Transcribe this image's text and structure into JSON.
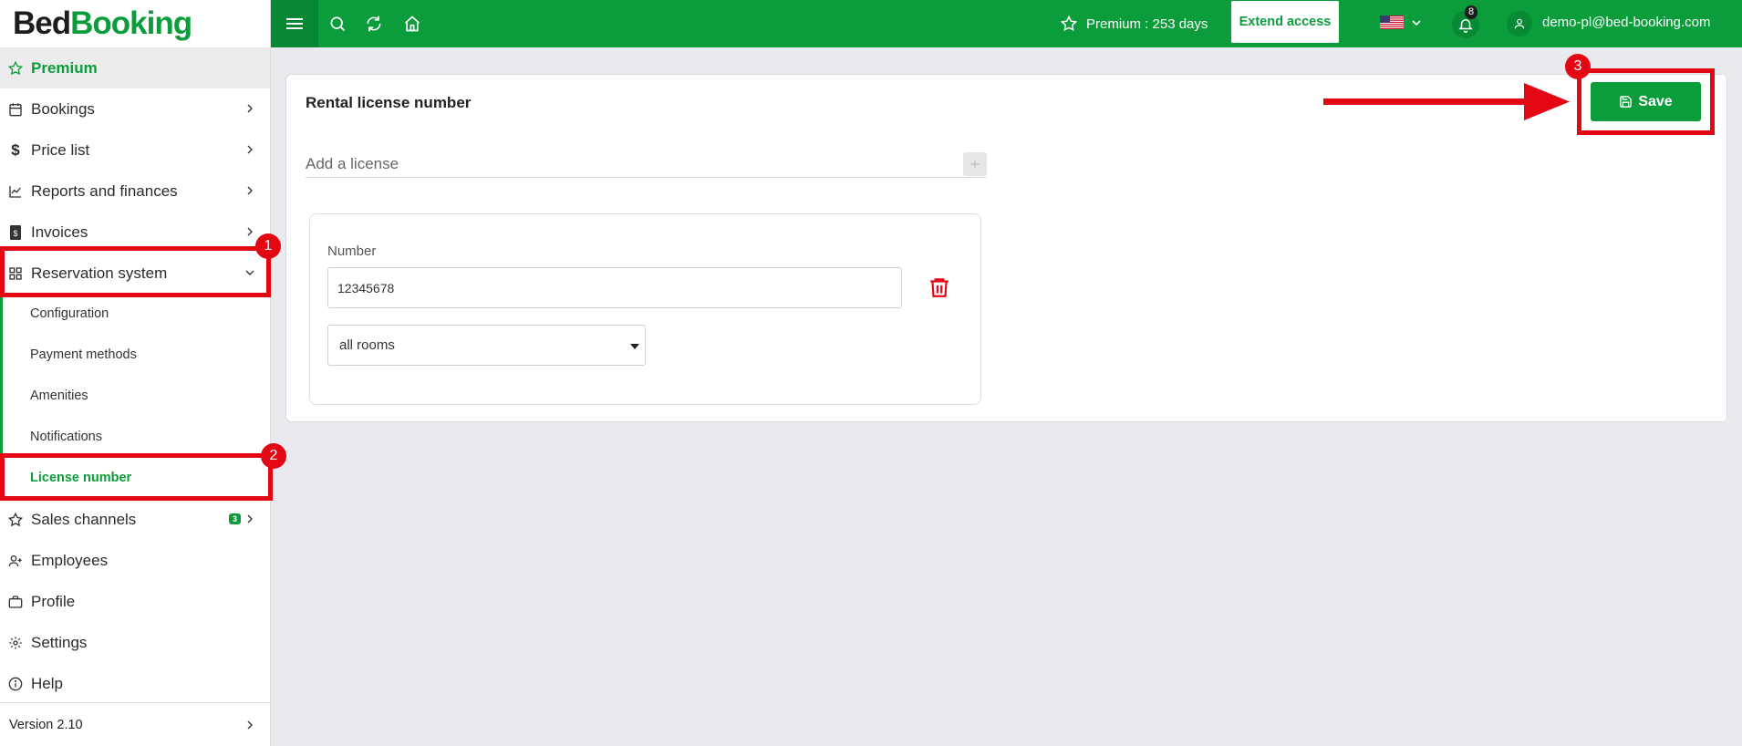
{
  "brand": {
    "part1": "Bed",
    "part2": "Booking"
  },
  "sidebar": {
    "premium": "Premium",
    "items": [
      {
        "label": "Bookings"
      },
      {
        "label": "Price list"
      },
      {
        "label": "Reports and finances"
      },
      {
        "label": "Invoices"
      },
      {
        "label": "Reservation system"
      }
    ],
    "sub_items": [
      {
        "label": "Configuration"
      },
      {
        "label": "Payment methods"
      },
      {
        "label": "Amenities"
      },
      {
        "label": "Notifications"
      },
      {
        "label": "License number"
      }
    ],
    "items_after": [
      {
        "label": "Sales channels",
        "badge": "3"
      },
      {
        "label": "Employees"
      },
      {
        "label": "Profile"
      },
      {
        "label": "Settings"
      },
      {
        "label": "Help"
      }
    ],
    "version": "Version 2.10"
  },
  "topbar": {
    "premium_text": "Premium : 253 days",
    "extend_label": "Extend access",
    "notifications_count": "8",
    "user_email": "demo-pl@bed-booking.com"
  },
  "card": {
    "title": "Rental license number",
    "save_label": "Save",
    "add_license_label": "Add a license",
    "number_label": "Number",
    "number_value": "12345678",
    "rooms_value": "all rooms"
  },
  "annotations": {
    "step1": "1",
    "step2": "2",
    "step3": "3"
  },
  "colors": {
    "brand_green": "#0b9d3b",
    "annotation_red": "#e30613"
  }
}
